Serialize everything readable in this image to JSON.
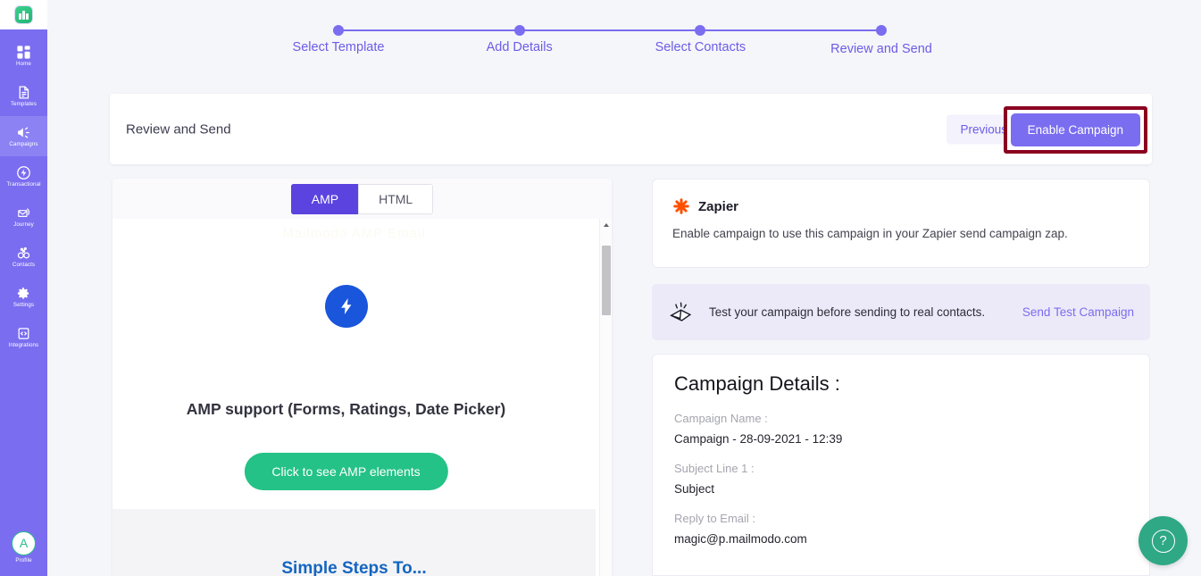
{
  "brand": {
    "primary": "#7a6df0",
    "accent_purple": "#6c5ce7",
    "tab_active": "#5b43e0",
    "green": "#24c286",
    "help_green": "#2fa885",
    "highlight_border": "#8b0020",
    "amp_blue": "#1a56db",
    "zapier_orange": "#ff4f00"
  },
  "sidebar": {
    "logo_name": "mailmodo-logo",
    "items": [
      {
        "label": "Home",
        "icon": "grid-icon",
        "active": false
      },
      {
        "label": "Templates",
        "icon": "document-icon",
        "active": false
      },
      {
        "label": "Campaigns",
        "icon": "megaphone-icon",
        "active": true
      },
      {
        "label": "Transactional",
        "icon": "bolt-icon",
        "active": false
      },
      {
        "label": "Journey",
        "icon": "journey-envelope-icon",
        "active": false
      },
      {
        "label": "Contacts",
        "icon": "contacts-icon",
        "active": false
      },
      {
        "label": "Settings",
        "icon": "gear-icon",
        "active": false
      },
      {
        "label": "Integrations",
        "icon": "code-clipboard-icon",
        "active": false
      }
    ],
    "profile": {
      "label": "Profile",
      "initial": "A"
    }
  },
  "stepper": {
    "steps": [
      {
        "label": "Select Template"
      },
      {
        "label": "Add Details"
      },
      {
        "label": "Select Contacts"
      },
      {
        "label": "Review and Send"
      }
    ]
  },
  "header": {
    "title": "Review and Send",
    "previous_label": "Previous",
    "enable_label": "Enable Campaign"
  },
  "preview": {
    "tabs": [
      {
        "label": "AMP",
        "active": true
      },
      {
        "label": "HTML",
        "active": false
      }
    ],
    "email": {
      "faint_top_text": "Mailmodo AMP Email",
      "amp_icon": "amp-bolt-icon",
      "heading": "AMP support (Forms, Ratings, Date Picker)",
      "cta_label": "Click to see AMP elements",
      "blue_heading": "Simple Steps To..."
    },
    "scrollbar": {
      "up_arrow": "caret-up-icon"
    }
  },
  "zapier": {
    "icon": "zapier-asterisk-icon",
    "name": "Zapier",
    "description": "Enable campaign to use this campaign in your Zapier send campaign zap."
  },
  "test_banner": {
    "icon": "envelope-send-icon",
    "text": "Test your campaign before sending to real contacts.",
    "link_label": "Send Test Campaign"
  },
  "campaign_details": {
    "title": "Campaign Details :",
    "fields": [
      {
        "label": "Campaign Name :",
        "value": "Campaign - 28-09-2021 - 12:39"
      },
      {
        "label": "Subject Line 1 :",
        "value": "Subject"
      },
      {
        "label": "Reply to Email :",
        "value": "magic@p.mailmodo.com"
      }
    ]
  },
  "help": {
    "icon": "question-mark-icon",
    "glyph": "?"
  }
}
